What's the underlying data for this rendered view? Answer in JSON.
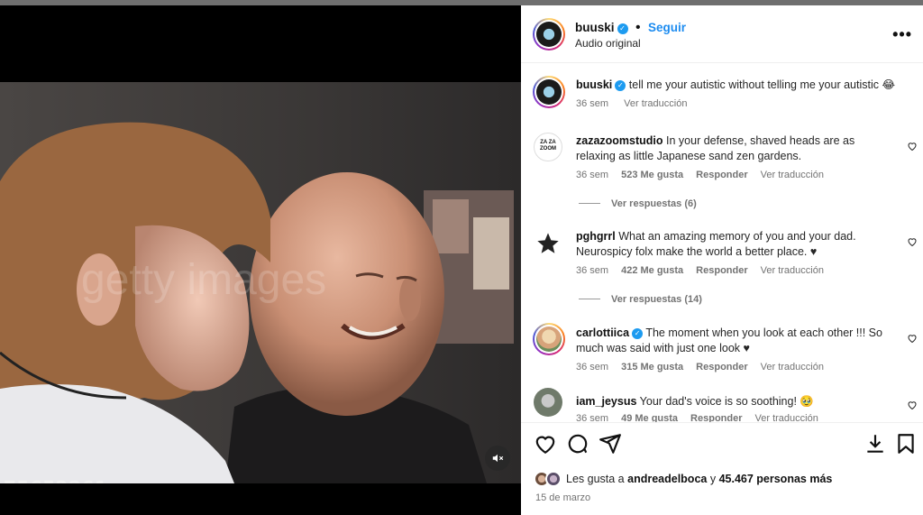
{
  "video": {
    "overlay_id": "75652261",
    "watermark_text": "Getty Images",
    "mute_icon": "speaker-muted-icon"
  },
  "header": {
    "username": "buuski",
    "follow_label": "Seguir",
    "audio_label": "Audio original",
    "more_icon": "more-options-icon"
  },
  "caption": {
    "username": "buuski",
    "text": "tell me your autistic without telling me your autistic 😂",
    "time": "36 sem",
    "translate": "Ver traducción"
  },
  "comments": [
    {
      "username": "zazazoomstudio",
      "text": "In your defense, shaved heads are as relaxing as little Japanese sand zen gardens.",
      "time": "36 sem",
      "likes": "523 Me gusta",
      "reply": "Responder",
      "translate": "Ver traducción",
      "replies": "Ver respuestas (6)",
      "avatar_text": "ZA ZA ZOOM"
    },
    {
      "username": "pghgrrl",
      "text": "What an amazing memory of you and your dad. Neurospicy folx make the world a better place. ♥",
      "time": "36 sem",
      "likes": "422 Me gusta",
      "reply": "Responder",
      "translate": "Ver traducción",
      "replies": "Ver respuestas (14)"
    },
    {
      "username": "carlottiica",
      "text": "The moment when you look at each other !!! So much was said with just one look ♥",
      "time": "36 sem",
      "likes": "315 Me gusta",
      "reply": "Responder",
      "translate": "Ver traducción"
    },
    {
      "username": "iam_jeysus",
      "text": "Your dad's voice is so soothing! 🥹",
      "time": "36 sem",
      "likes": "49 Me gusta",
      "reply": "Responder",
      "translate": "Ver traducción"
    }
  ],
  "footer": {
    "likes_prefix": "Les gusta a",
    "likes_user": "andreadelboca",
    "likes_mid": "y",
    "likes_count": "45.467 personas más",
    "date": "15 de marzo"
  },
  "colors": {
    "follow": "#1d8cf0",
    "verified": "#1d9bf0",
    "muted_text": "#737373"
  }
}
